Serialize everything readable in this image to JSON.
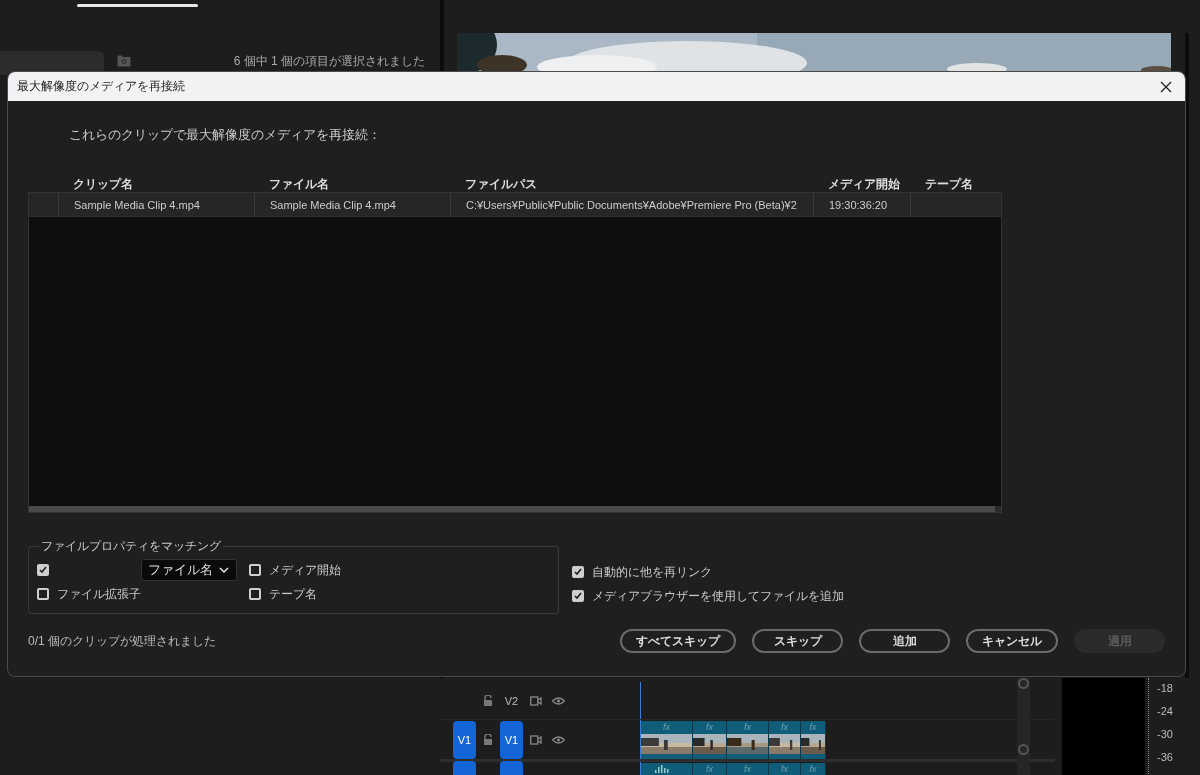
{
  "project_panel": {
    "status": "6 個中 1 個の項目が選択されました"
  },
  "dialog": {
    "title": "最大解像度のメディアを再接続",
    "instruction": "これらのクリップで最大解像度のメディアを再接続：",
    "table": {
      "columns": [
        "クリップ名",
        "ファイル名",
        "ファイルパス",
        "メディア開始",
        "テープ名"
      ],
      "rows": [
        {
          "cells": [
            "Sample Media Clip 4.mp4",
            "Sample Media Clip 4.mp4",
            "C:¥Users¥Public¥Public Documents¥Adobe¥Premiere Pro (Beta)¥2",
            "19:30:36:20"
          ]
        }
      ]
    },
    "match": {
      "legend": "ファイルプロパティをマッチング",
      "options": [
        {
          "kind": "select",
          "checked": true,
          "value": "ファイル名"
        },
        {
          "kind": "check",
          "label": "メディア開始",
          "checked": false
        },
        {
          "kind": "check",
          "label": "ファイル拡張子",
          "checked": false
        },
        {
          "kind": "check",
          "label": "テープ名",
          "checked": false
        }
      ]
    },
    "extra_options": [
      {
        "label": "自動的に他を再リンク",
        "checked": true
      },
      {
        "label": "メディアブラウザーを使用してファイルを追加",
        "checked": true
      }
    ],
    "status": "0/1 個のクリップが処理されました",
    "buttons": [
      {
        "label": "すべてスキップ",
        "disabled": false
      },
      {
        "label": "スキップ",
        "disabled": false
      },
      {
        "label": "追加",
        "disabled": false
      },
      {
        "label": "キャンセル",
        "disabled": false
      },
      {
        "label": "適用",
        "disabled": true
      }
    ]
  },
  "timeline": {
    "tracks": [
      {
        "label": "V2",
        "targeted": false,
        "source_patched": false
      },
      {
        "label": "V1",
        "source_label": "V1",
        "targeted": true,
        "source_patched": true,
        "clips": [
          {
            "badge": "fx"
          },
          {
            "badge": "fx"
          },
          {
            "badge": "fx"
          },
          {
            "badge": "fx"
          },
          {
            "badge": "fx"
          }
        ]
      },
      {
        "targeted": true,
        "source_patched": true,
        "clips": [
          {
            "kind": "audio"
          },
          {
            "badge": "fx"
          },
          {
            "badge": "fx"
          },
          {
            "badge": "fx"
          },
          {
            "badge": "fx"
          }
        ]
      }
    ]
  },
  "meter": {
    "labels": [
      "-18",
      "-24",
      "-30",
      "-36"
    ]
  }
}
